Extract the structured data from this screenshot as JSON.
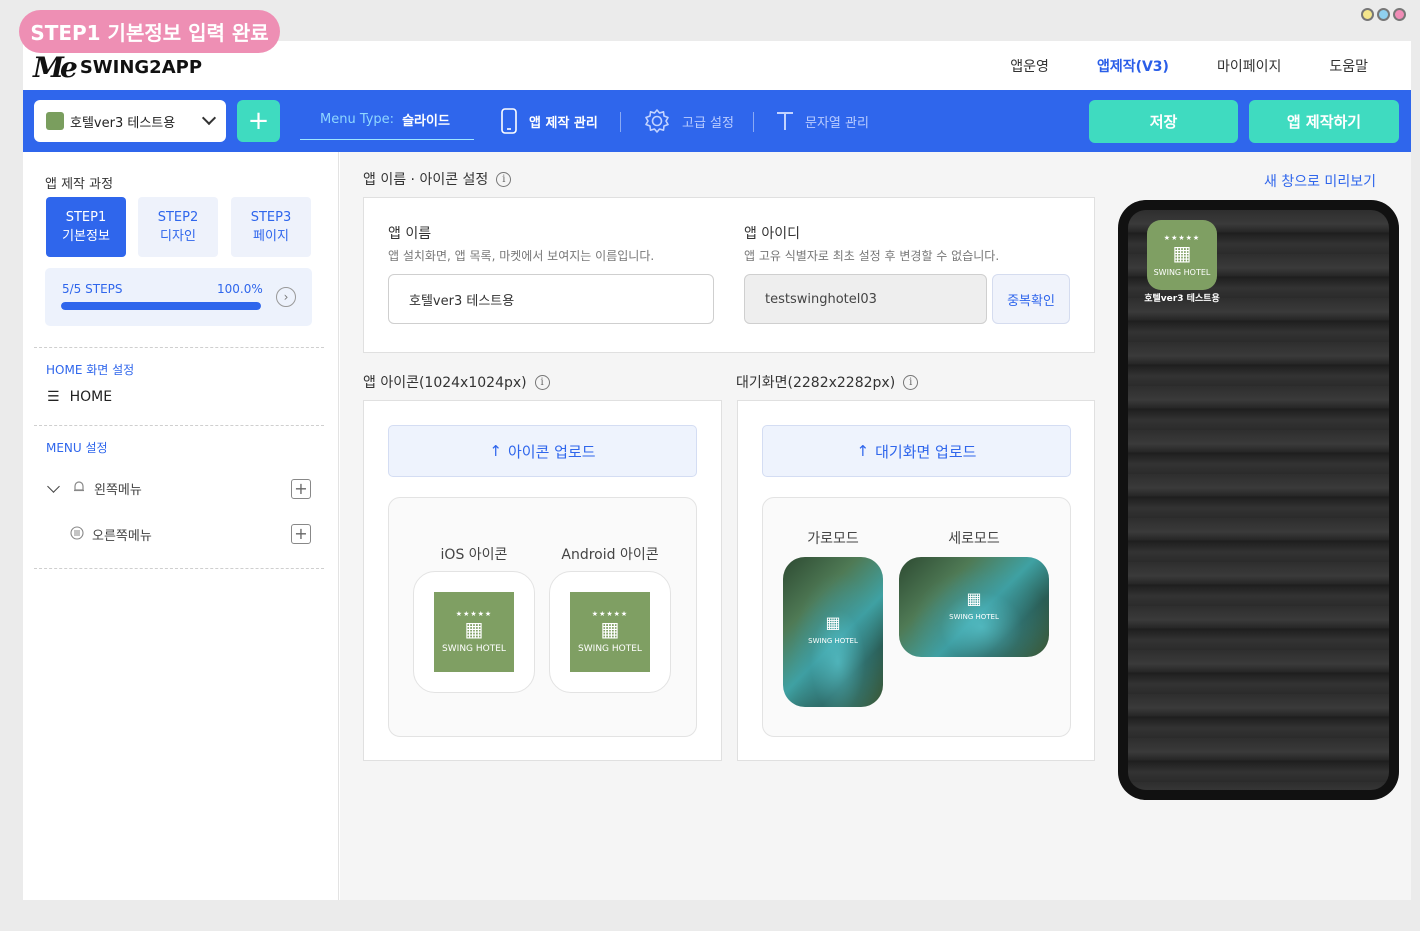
{
  "step_badge": "STEP1 기본정보 입력 완료",
  "colors": {
    "primary": "#2f66ec",
    "accent": "#3fdbc0",
    "badge": "#ee8fb4",
    "icon_green": "#7f9f63"
  },
  "brand": {
    "mark": "Me",
    "name": "SWING2APP"
  },
  "topnav": [
    "앱운영",
    "앱제작(V3)",
    "마이페이지",
    "도움말"
  ],
  "toolbar": {
    "app_select": "호텔ver3 테스트용",
    "add": "+",
    "menu_type_label": "Menu Type:",
    "menu_type_value": "슬라이드",
    "tool1": "앱 제작 관리",
    "tool2": "고급 설정",
    "tool3": "문자열 관리",
    "save": "저장",
    "make": "앱 제작하기",
    "icons": [
      "phone-icon",
      "gear-icon",
      "text-icon"
    ]
  },
  "sidebar": {
    "title": "앱 제작 과정",
    "steps": [
      {
        "l1": "STEP1",
        "l2": "기본정보"
      },
      {
        "l1": "STEP2",
        "l2": "디자인"
      },
      {
        "l1": "STEP3",
        "l2": "페이지"
      }
    ],
    "progress_label": "5/5 STEPS",
    "progress_pct": "100.0%",
    "progress_value": 1.0,
    "home_section": "HOME 화면 설정",
    "home_item": "HOME",
    "menu_section": "MENU 설정",
    "menu_left": "왼쪽메뉴",
    "menu_right": "오른쪽메뉴"
  },
  "main": {
    "name_section": "앱 이름 · 아이콘 설정",
    "app_name_title": "앱 이름",
    "app_name_desc": "앱 설치화면, 앱 목록, 마켓에서 보여지는 이름입니다.",
    "app_name_value": "호텔ver3 테스트용",
    "app_id_title": "앱 아이디",
    "app_id_desc": "앱 고유 식별자로 최초 설정 후 변경할 수 없습니다.",
    "app_id_value": "testswinghotel03",
    "dup_check": "중복확인",
    "icon_section": "앱 아이콘(1024x1024px)",
    "splash_section": "대기화면(2282x2282px)",
    "icon_upload": "아이콘 업로드",
    "splash_upload": "대기화면 업로드",
    "ios_icon": "iOS 아이콘",
    "android_icon": "Android 아이콘",
    "landscape": "가로모드",
    "portrait": "세로모드",
    "hotel_text": "SWING HOTEL",
    "stars": "★★★★★"
  },
  "preview": {
    "link": "새 창으로 미리보기",
    "app_label": "호텔ver3 테스트용"
  }
}
